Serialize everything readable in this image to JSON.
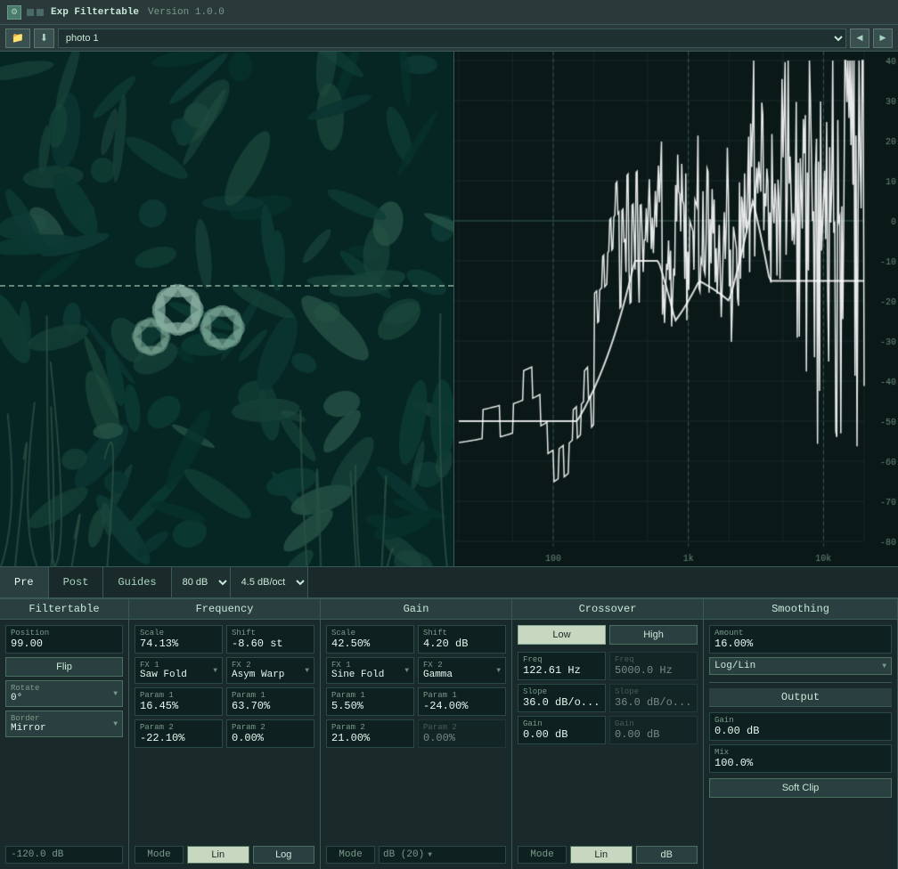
{
  "titlebar": {
    "app_name": "Exp Filtertable",
    "version": "Version 1.0.0"
  },
  "toolbar": {
    "folder_btn": "📁",
    "save_btn": "⬇",
    "preset_name": "photo 1",
    "prev_btn": "◀",
    "next_btn": "▶"
  },
  "tabs": {
    "pre": "Pre",
    "post": "Post",
    "guides": "Guides",
    "db_range": "80 dB",
    "slope": "4.5 dB/oct"
  },
  "panels": {
    "filtertable": {
      "header": "Filtertable",
      "position_label": "Position",
      "position_value": "99.00",
      "flip_label": "Flip",
      "rotate_label": "Rotate",
      "rotate_value": "0°",
      "border_label": "Border",
      "border_value": "Mirror",
      "bottom_value": "-120.0 dB"
    },
    "frequency": {
      "header": "Frequency",
      "scale_label": "Scale",
      "scale_value": "74.13%",
      "shift_label": "Shift",
      "shift_value": "-8.60 st",
      "fx1_label": "FX 1",
      "fx1_value": "Saw Fold",
      "fx2_label": "FX 2",
      "fx2_value": "Asym Warp",
      "param1a_label": "Param 1",
      "param1a_value": "16.45%",
      "param1b_label": "Param 1",
      "param1b_value": "63.70%",
      "param2a_label": "Param 2",
      "param2a_value": "-22.10%",
      "param2b_label": "Param 2",
      "param2b_value": "0.00%",
      "mode_label": "Mode",
      "mode_lin": "Lin",
      "mode_log": "Log"
    },
    "gain": {
      "header": "Gain",
      "scale_label": "Scale",
      "scale_value": "42.50%",
      "shift_label": "Shift",
      "shift_value": "4.20 dB",
      "fx1_label": "FX 1",
      "fx1_value": "Sine Fold",
      "fx2_label": "FX 2",
      "fx2_value": "Gamma",
      "param1a_label": "Param 1",
      "param1a_value": "5.50%",
      "param1b_label": "Param 1",
      "param1b_value": "-24.00%",
      "param2a_label": "Param 2",
      "param2a_value": "21.00%",
      "param2b_label": "Param 2",
      "param2b_value": "0.00%",
      "mode_label": "Mode",
      "mode_db": "dB (20)"
    },
    "crossover": {
      "header": "Crossover",
      "low_label": "Low",
      "high_label": "High",
      "freq1_label": "Freq",
      "freq1_value": "122.61 Hz",
      "freq2_label": "Freq",
      "freq2_value": "5000.0 Hz",
      "slope1_label": "Slope",
      "slope1_value": "36.0 dB/o...",
      "slope2_label": "Slope",
      "slope2_value": "36.0 dB/o...",
      "gain1_label": "Gain",
      "gain1_value": "0.00 dB",
      "gain2_label": "Gain",
      "gain2_value": "0.00 dB",
      "mode_label": "Mode",
      "mode_lin": "Lin",
      "mode_db": "dB"
    },
    "smoothing": {
      "header": "Smoothing",
      "amount_label": "Amount",
      "amount_value": "16.00%",
      "loglin_label": "Log/Lin",
      "output_header": "Output",
      "gain_label": "Gain",
      "gain_value": "0.00 dB",
      "mix_label": "Mix",
      "mix_value": "100.0%",
      "softclip_label": "Soft Clip"
    }
  },
  "spectrum": {
    "db_labels": [
      "40",
      "30",
      "20",
      "10",
      "0",
      "-10",
      "-20",
      "-30",
      "-40",
      "-50",
      "-60",
      "-70",
      "-80"
    ],
    "freq_labels": [
      "100",
      "1k",
      "10k"
    ]
  },
  "colors": {
    "bg": "#0e2020",
    "panel_bg": "#1a2a2a",
    "header_bg": "#2a4040",
    "border": "#3a5a5a",
    "text_primary": "#e8f8f0",
    "text_secondary": "#a8d4c0",
    "text_dim": "#7a9a8a",
    "accent": "#c8d8c0",
    "curve_color": "#ffffff"
  }
}
